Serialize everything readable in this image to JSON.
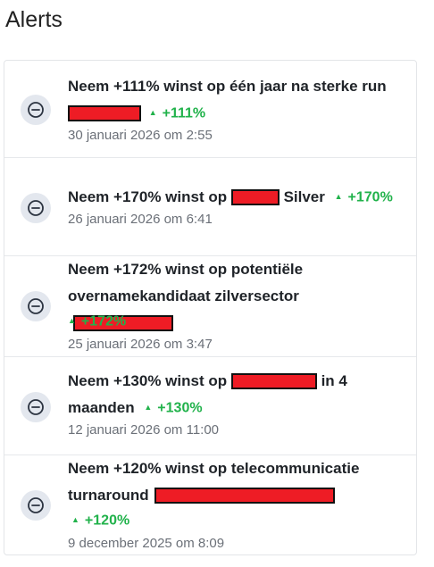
{
  "page": {
    "title": "Alerts"
  },
  "colors": {
    "gain": "#21b24b",
    "redaction": "#ee1c25",
    "dismiss_bg": "#e3e7ee",
    "date_text": "#6b7078"
  },
  "alerts": [
    {
      "title": "Neem +111% winst op één jaar na sterke run",
      "title_suffix": "",
      "gain": "+111%",
      "date": "30 januari 2026 om 2:55",
      "icon": "minus-circle-icon"
    },
    {
      "title": "Neem +170% winst op",
      "title_suffix": "Silver",
      "gain": "+170%",
      "date": "26 januari 2026 om 6:41",
      "icon": "minus-circle-icon"
    },
    {
      "title": "Neem +172% winst op potentiële overnamekandidaat zilversector",
      "title_suffix": "",
      "gain": "+172%",
      "date": "25 januari 2026 om 3:47",
      "icon": "minus-circle-icon"
    },
    {
      "title": "Neem +130% winst op",
      "title_suffix": "in 4 maanden",
      "gain": "+130%",
      "date": "12 januari 2026 om 11:00",
      "icon": "minus-circle-icon"
    },
    {
      "title": "Neem +120% winst op telecommunicatie turnaround",
      "title_suffix": "",
      "gain": "+120%",
      "date": "9 december 2025 om 8:09",
      "icon": "minus-circle-icon"
    }
  ]
}
